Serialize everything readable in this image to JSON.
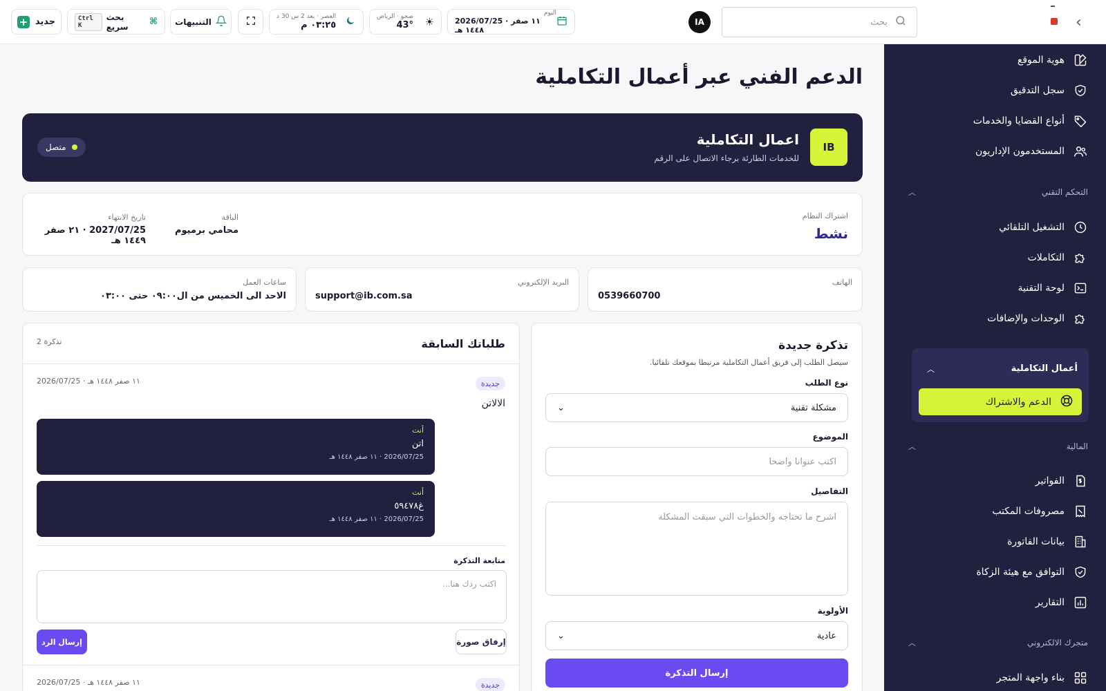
{
  "topbar": {
    "new_label": "جديد",
    "quick_search": "بحث سريع",
    "quick_kbd": "Ctrl K",
    "notifications": "التنبيهات",
    "prayer_label": "العصر · بعد 2 س 30 د",
    "prayer_time": "٠٣:٢٥ م",
    "weather_label": "صحو · الرياض",
    "weather_temp": "43°",
    "date_label": "اليوم",
    "date_value": "2026/07/25 · ١١ صفر ١٤٤٨ هـ",
    "avatar": "IA",
    "search_placeholder": "بحث"
  },
  "sidebar": {
    "items_top": [
      "هوية الموقع",
      "سجل التدقيق",
      "أنواع القضايا والخدمات",
      "المستخدمون الإداريون"
    ],
    "section_tech": "التحكم التقني",
    "items_tech": [
      "التشغيل التلقائي",
      "التكاملات",
      "لوحة التقنية",
      "الوحدات والإضافات"
    ],
    "group_title": "أعمال التكاملية",
    "active_item": "الدعم والاشتراك",
    "section_finance": "المالية",
    "items_finance": [
      "الفواتير",
      "مصروفات المكتب",
      "بيانات الفاتورة",
      "التوافق مع هيئة الزكاة",
      "التقارير"
    ],
    "section_store": "متجرك الالكتروني",
    "items_store": [
      "بناء واجهة المتجر"
    ]
  },
  "main": {
    "page_title": "الدعم الفني عبر أعمال التكاملية",
    "hero": {
      "logo": "IB",
      "name": "اعمال التكاملية",
      "subtitle": "للخدمات الطارئة برجاء الاتصال على الرقم",
      "status": "متصل"
    },
    "subscription": {
      "label": "اشتراك النظام",
      "status": "نشط",
      "plan_label": "الباقة",
      "plan": "محامي برميوم",
      "expiry_label": "تاريخ الانتهاء",
      "expiry": "2027/07/25 · ٢١ صفر ١٤٤٩ هـ"
    },
    "contact": {
      "phone_label": "الهاتف",
      "phone": "0539660700",
      "email_label": "البريد الإلكتروني",
      "email": "support@ib.com.sa",
      "hours_label": "ساعات العمل",
      "hours": "الاحد الى الخميس من ال٠٩:٠٠ حتى ٠٣:٠٠"
    },
    "new_ticket": {
      "title": "تذكرة جديدة",
      "subtitle": "سيصل الطلب إلى فريق أعمال التكاملية مرتبطا بموقعك تلقائيا.",
      "type_label": "نوع الطلب",
      "type_value": "مشكلة تقنية",
      "subject_label": "الموضوع",
      "subject_placeholder": "اكتب عنوانا واضحا",
      "details_label": "التفاصيل",
      "details_placeholder": "اشرح ما تحتاجه والخطوات التي سبقت المشكلة",
      "priority_label": "الأولوية",
      "priority_value": "عادية",
      "submit": "إرسال التذكرة"
    },
    "previous": {
      "title": "طلباتك السابقة",
      "count": "2 تذكرة",
      "tickets": [
        {
          "badge": "جديدة",
          "date": "2026/07/25 · ١١ صفر ١٤٤٨ هـ",
          "subject": "الالاتن",
          "messages": [
            {
              "who": "أنت",
              "text": "اتن",
              "date": "2026/07/25 · ١١ صفر ١٤٤٨ هـ"
            },
            {
              "who": "أنت",
              "text": "غ٥٩٤٧٨",
              "date": "2026/07/25 · ١١ صفر ١٤٤٨ هـ"
            }
          ]
        },
        {
          "badge": "جديدة",
          "date": "2026/07/25 · ١١ صفر ١٤٤٨ هـ"
        }
      ],
      "follow_label": "متابعة التذكرة",
      "reply_placeholder": "اكتب ردك هنا...",
      "attach": "إرفاق صورة",
      "send": "إرسال الرد"
    }
  }
}
